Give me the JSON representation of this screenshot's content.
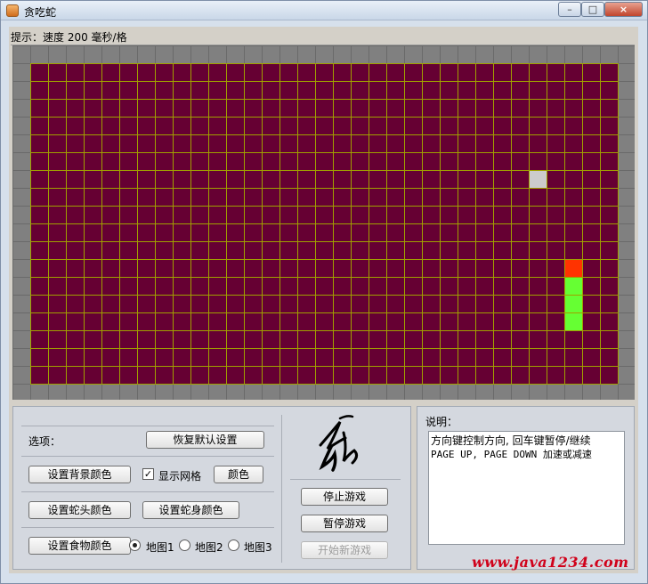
{
  "window": {
    "title": "贪吃蛇",
    "controls": {
      "minimize": "–",
      "maximize": "□",
      "close": "×"
    }
  },
  "hint": {
    "text": "提示：速度 200 毫秒/格"
  },
  "game": {
    "columns": 34,
    "rows": 20,
    "colors": {
      "wall": "#808080",
      "background": "#660033",
      "grid": "#a0a000",
      "snake_head": "#ff3300",
      "snake_body": "#66ff33",
      "food": "#cccccc"
    },
    "food": {
      "col": 28,
      "row": 6
    },
    "snake": [
      {
        "col": 30,
        "row": 11
      },
      {
        "col": 30,
        "row": 12
      },
      {
        "col": 30,
        "row": 13
      },
      {
        "col": 30,
        "row": 14
      }
    ]
  },
  "options": {
    "heading": "选项：",
    "restore_defaults": "恢复默认设置",
    "set_bg_color": "设置背景颜色",
    "show_grid": "显示网格",
    "show_grid_checked": true,
    "grid_color": "颜色",
    "set_head_color": "设置蛇头颜色",
    "set_body_color": "设置蛇身颜色",
    "set_food_color": "设置食物颜色",
    "maps": [
      {
        "label": "地图1",
        "selected": true
      },
      {
        "label": "地图2",
        "selected": false
      },
      {
        "label": "地图3",
        "selected": false
      }
    ]
  },
  "controls": {
    "stop": "停止游戏",
    "pause": "暂停游戏",
    "new_game": "开始新游戏"
  },
  "description": {
    "heading": "说明：",
    "line1": "方向键控制方向, 回车键暂停/继续",
    "line2": "PAGE UP, PAGE DOWN 加速或减速"
  },
  "watermark": "www.java1234.com"
}
